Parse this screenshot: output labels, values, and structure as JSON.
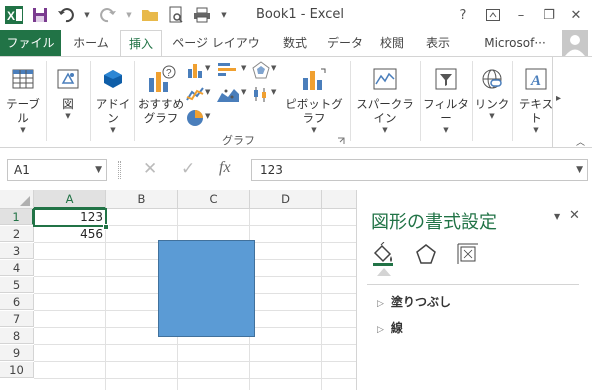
{
  "window": {
    "title": "Book1 - Excel",
    "help": "?",
    "minimize": "–",
    "restore": "❐",
    "close": "✕"
  },
  "tabs": {
    "file": "ファイル",
    "home": "ホーム",
    "insert": "挿入",
    "page_layout": "ページ レイアウト",
    "formulas": "数式",
    "data": "データ",
    "review": "校閲",
    "view": "表示",
    "microsoft": "Microsof···"
  },
  "ribbon": {
    "table": "テーブル",
    "illustrations": "図",
    "addin_1": "アドイ",
    "addin_2": "ン",
    "recommended_1": "おすすめ",
    "recommended_2": "グラフ",
    "pivot_chart": "ピボットグラフ",
    "sparklines": "スパークライン",
    "filters": "フィルター",
    "links": "リンク",
    "text": "テキスト",
    "charts_group": "グラフ",
    "scroll_right": "▸"
  },
  "formula_bar": {
    "name_box": "A1",
    "cancel": "✕",
    "enter": "✓",
    "fx": "fx",
    "value": "123"
  },
  "sheet": {
    "columns": [
      "A",
      "B",
      "C",
      "D"
    ],
    "rows": [
      "1",
      "2",
      "3",
      "4",
      "5",
      "6",
      "7",
      "8",
      "9",
      "10"
    ],
    "a1": "123",
    "a2": "456"
  },
  "pane": {
    "title": "図形の書式設定",
    "menu": "▼",
    "close": "✕",
    "fill": "塗りつぶし",
    "line": "線",
    "expand": "▷"
  },
  "colors": {
    "excel_green": "#217346",
    "shape_fill": "#5b9bd5",
    "shape_border": "#41719c"
  }
}
